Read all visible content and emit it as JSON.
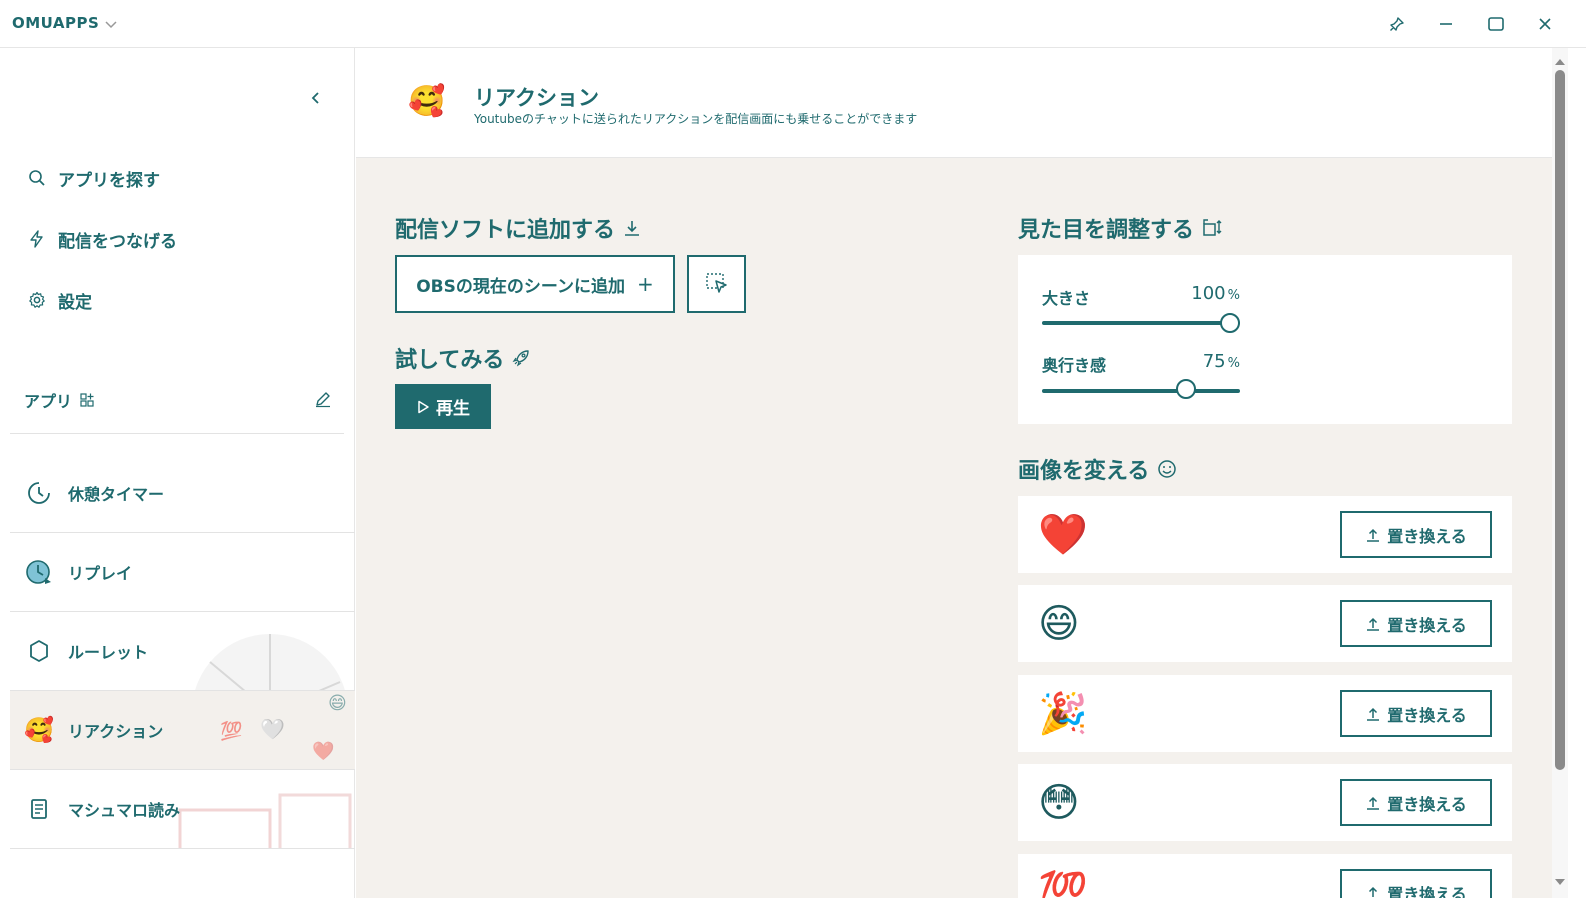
{
  "titlebar": {
    "app_name": "OMUAPPS",
    "icons": [
      "chevron-down-icon",
      "pin-icon",
      "minimize-icon",
      "maximize-icon",
      "close-icon"
    ]
  },
  "sidebar": {
    "nav": [
      {
        "label": "アプリを探す",
        "icon": "search-icon"
      },
      {
        "label": "配信をつなげる",
        "icon": "lightning-icon"
      },
      {
        "label": "設定",
        "icon": "gear-icon"
      }
    ],
    "apps_header": "アプリ",
    "apps": [
      {
        "label": "休憩タイマー",
        "icon": "timer-icon"
      },
      {
        "label": "リプレイ",
        "icon": "replay-icon"
      },
      {
        "label": "ルーレット",
        "icon": "roulette-icon"
      },
      {
        "label": "リアクション",
        "icon": "reaction-emoji-icon",
        "active": true
      },
      {
        "label": "マシュマロ読み",
        "icon": "document-icon"
      }
    ]
  },
  "header": {
    "emoji": "🥰",
    "title": "リアクション",
    "subtitle": "Youtubeのチャットに送られたリアクションを配信画面にも乗せることができます"
  },
  "add_section": {
    "title": "配信ソフトに追加する",
    "obs_button": "OBSの現在のシーンに追加",
    "plus": "+"
  },
  "try_section": {
    "title": "試してみる",
    "play_button": "再生"
  },
  "appearance": {
    "title": "見た目を調整する",
    "size_label": "大きさ",
    "size_value": "100",
    "size_value_fraction": 1.0,
    "depth_label": "奥行き感",
    "depth_value": "75",
    "depth_value_fraction": 0.73,
    "unit": "%"
  },
  "images": {
    "title": "画像を変える",
    "replace_label": "置き換える",
    "items": [
      {
        "emoji": "❤️"
      },
      {
        "emoji": "😄"
      },
      {
        "emoji": "🎉"
      },
      {
        "emoji": "😳"
      },
      {
        "emoji": "💯"
      }
    ]
  },
  "colors": {
    "accent": "#1f6a6e",
    "background": "#f4f1ed",
    "active_row": "#f3f0ec"
  }
}
